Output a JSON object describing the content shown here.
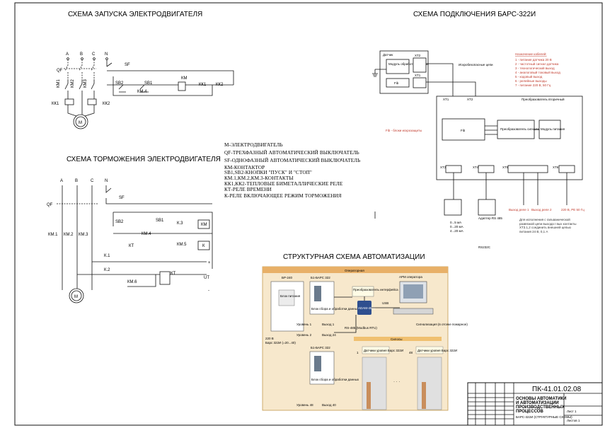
{
  "titles": {
    "start": "СХЕМА ЗАПУСКА ЭЛЕКТРОДВИГАТЕЛЯ",
    "brake": "СХЕМА ТОРМОЖЕНИЯ ЭЛЕКТРОДВИГАТЕЛЯ",
    "connect": "СХЕМА ПОДКЛЮЧЕНИЯ БАРС-322И",
    "struct": "СТРУКТУРНАЯ СХЕМА АВТОМАТИЗАЦИИ"
  },
  "legend": [
    "М-ЭЛЕКТРОДВИГАТЕЛЬ",
    "QF-ТРЕХФАЗНЫЙ АВТОМАТИЧЕСКИЙ ВЫКЛЮЧАТЕЛЬ",
    "SF-ОДНОФАЗНЫЙ АВТОМАТИЧЕСКИЙ ВЫКЛЮЧАТЕЛЬ",
    "КМ-КОНТАКТОР",
    "SB1,SB2-КНОПКИ \"ПУСК\" И \"СТОП\"",
    "КМ.1,КМ.2,КМ.3-КОНТАКТЫ",
    "КК1,КК2-ТЕПЛОВЫЕ БИМЕТАЛЛИЧЕСКИЕ РЕЛЕ",
    "КТ-РЕЛЕ ВРЕМЕНИ",
    "К-РЕЛЕ ВКЛЮЧАЮЩЕЕ РЕЖИМ ТОРМОЖЕНИЯ"
  ],
  "start_scheme": {
    "phases": [
      "A",
      "B",
      "C",
      "N"
    ],
    "qf": "QF",
    "sf": "SF",
    "km_contacts": [
      "КМ1",
      "КМ2",
      "КМ3"
    ],
    "kk": [
      "КК1",
      "КК2"
    ],
    "sb2": "SB2",
    "sb1": "SB1",
    "km4": "КМ.4",
    "km": "КМ",
    "kk1": "КК1",
    "kk2": "КК2",
    "motor": "М"
  },
  "brake_scheme": {
    "phases": [
      "A",
      "B",
      "C",
      "N"
    ],
    "qf": "QF",
    "sf": "SF",
    "km_contacts": [
      "КМ.1",
      "КМ.2",
      "КМ.3"
    ],
    "sb2": "SB2",
    "sb1": "SB1",
    "km4": "КМ.4",
    "kt": "КТ",
    "k3": "К.3",
    "km": "КМ",
    "km5": "КМ.5",
    "k": "К",
    "k1": "К.1",
    "k2": "К.2",
    "km6": "КМ.6",
    "kt2": "КТ",
    "plus": "+",
    "minus": "-",
    "ut": "UT",
    "motor": "М"
  },
  "connection": {
    "sensor": "Датчик",
    "sensor_module": "Модуль обработки сигнала",
    "fib": "Fib",
    "xt2": "XT2",
    "xt1": "XT1",
    "intrinsic": "Искробезопасные цепи",
    "converter": "Преобразователь вторичный",
    "converter_signal": "Преобразователь сигнала",
    "power_module": "Модуль питания",
    "fib_note": "Fib - блоки искрозащиты",
    "terminals": [
      "XT3",
      "XT4",
      "XT5",
      "XT6"
    ],
    "outputs": [
      "Выход реле 1",
      "Выход реле 2"
    ],
    "power_out": "220 В, PE 50 Гц",
    "adapter": "Адаптер RS 485",
    "rs232": "RS232C",
    "currents": [
      "0...5 мА",
      "0...20 мА",
      "4...20 мА"
    ],
    "cables_title": "Назначение кабелей:",
    "cables": [
      "1 - питание датчика 20 В",
      "2 - частотный сигнал датчика",
      "3 - технологический выход",
      "4 - аналоговый токовый выход",
      "5 - кодовый выход",
      "6 - релейные выходы",
      "7 - питание 220 В, 50 Гц"
    ],
    "note": "Для исполнения с гальванической развязкой цепи выхода I вых контакты XT3.1,2 соединить внешней цепью питания 24 В, 0,1 А"
  },
  "structure": {
    "operator": "Операторная",
    "objects": "Силосы",
    "br240": "БР-240",
    "psu": "Блок питания",
    "b1": "Б1-БАРС 322",
    "b2": "Б1-БАРС 322",
    "info_unit": "Блок сбора и обработки данных",
    "power_220": "220 В",
    "bars_power": "Барс 322И (=20...40)",
    "levels": [
      "Уровень 1",
      "Уровень 2",
      "Уровень 48"
    ],
    "outputs": [
      "Выход 1",
      "Выход 24",
      "Выход 40"
    ],
    "converter": "Преобразователь интерфейса",
    "adam": "ADAM-4520",
    "usb": "USB",
    "rs485": "RS-485 (Modbus RTU)",
    "pc": "АРМ оператора",
    "alarm": "Сигнализация (в отсеке пожарное)",
    "sensor_1": "Датчики уровня Барс 322И",
    "sensor_2": "Датчики уровня Барс 322И",
    "silo_1": "1",
    "silo_2": "48",
    "ellipsis": "· · ·"
  },
  "stamp": {
    "code": "ПК-41.01.02.08",
    "title_lines": [
      "ОСНОВЫ АВТОМАТИКИ",
      "И АВТОМАТИЗАЦИИ",
      "ПРОИЗВОДСТВЕННЫХ",
      "ПРОЦЕССОВ"
    ],
    "subtitle": "БАРС-322И (СТРУКТУРНЫЕ СХЕМЫ)",
    "sheet": "Лист 1",
    "sheets": "Листов 1"
  }
}
